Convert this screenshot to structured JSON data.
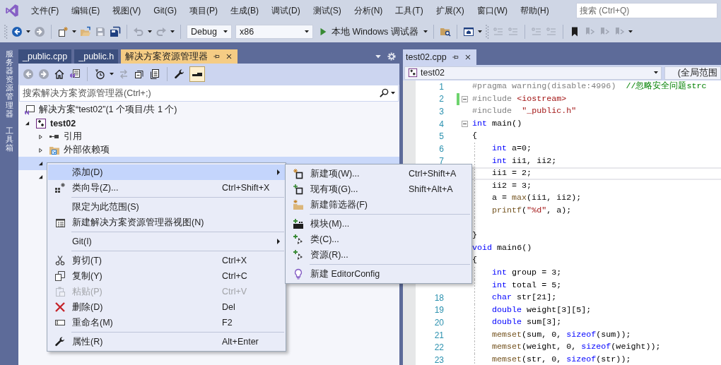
{
  "menu_bar": {
    "items": [
      "文件(F)",
      "编辑(E)",
      "视图(V)",
      "Git(G)",
      "项目(P)",
      "生成(B)",
      "调试(D)",
      "测试(S)",
      "分析(N)",
      "工具(T)",
      "扩展(X)",
      "窗口(W)",
      "帮助(H)"
    ],
    "search": {
      "placeholder": "搜索 (Ctrl+Q)"
    }
  },
  "toolbar": {
    "configuration": "Debug",
    "platform": "x86",
    "run_target": "本地 Windows 调试器"
  },
  "side_tabs": [
    "服务器资源管理器",
    "工具箱"
  ],
  "solution_explorer": {
    "tabs": [
      {
        "label": "_public.cpp",
        "selected": false
      },
      {
        "label": "_public.h",
        "selected": false
      },
      {
        "label": "解决方案资源管理器",
        "selected": true
      }
    ],
    "preview_toggle": {
      "on": true
    },
    "search": {
      "placeholder": "搜索解决方案资源管理器(Ctrl+;)"
    },
    "tree": [
      {
        "label": "解决方案“test02”(1 个项目/共 1 个)",
        "children": [
          {
            "label": "test02",
            "expanded": true,
            "selected": false,
            "children": [
              {
                "label": "引用",
                "expanded": false,
                "selected": false
              },
              {
                "label": "外部依赖项",
                "expanded": false,
                "selected": false
              },
              {
                "expanded": true,
                "selected": true
              },
              {
                "expanded": true,
                "selected": false
              }
            ]
          }
        ]
      }
    ]
  },
  "context_menu": {
    "items": [
      {
        "kind": "item",
        "label": "添加(D)",
        "submenu": true,
        "selected": true,
        "disabled": false
      },
      {
        "kind": "item",
        "label": "类向导(Z)...",
        "shortcut": "Ctrl+Shift+X",
        "submenu": false,
        "selected": false,
        "disabled": false
      },
      {
        "kind": "separator"
      },
      {
        "kind": "item",
        "label": "限定为此范围(S)",
        "submenu": false,
        "selected": false,
        "disabled": false
      },
      {
        "kind": "item",
        "label": "新建解决方案资源管理器视图(N)",
        "submenu": false,
        "selected": false,
        "disabled": false
      },
      {
        "kind": "separator"
      },
      {
        "kind": "item",
        "label": "Git(I)",
        "submenu": true,
        "selected": false,
        "disabled": false
      },
      {
        "kind": "separator"
      },
      {
        "kind": "item",
        "label": "剪切(T)",
        "shortcut": "Ctrl+X",
        "submenu": false,
        "selected": false,
        "disabled": false
      },
      {
        "kind": "item",
        "label": "复制(Y)",
        "shortcut": "Ctrl+C",
        "submenu": false,
        "selected": false,
        "disabled": false
      },
      {
        "kind": "item",
        "label": "粘贴(P)",
        "shortcut": "Ctrl+V",
        "submenu": false,
        "selected": false,
        "disabled": true
      },
      {
        "kind": "item",
        "label": "删除(D)",
        "shortcut": "Del",
        "submenu": false,
        "selected": false,
        "disabled": false
      },
      {
        "kind": "item",
        "label": "重命名(M)",
        "shortcut": "F2",
        "submenu": false,
        "selected": false,
        "disabled": false
      },
      {
        "kind": "separator"
      },
      {
        "kind": "item",
        "label": "属性(R)",
        "shortcut": "Alt+Enter",
        "submenu": false,
        "selected": false,
        "disabled": false
      }
    ]
  },
  "submenu": {
    "items": [
      {
        "kind": "item",
        "label": "新建项(W)...",
        "shortcut": "Ctrl+Shift+A",
        "selected": false,
        "disabled": false
      },
      {
        "kind": "item",
        "label": "现有项(G)...",
        "shortcut": "Shift+Alt+A",
        "selected": false,
        "disabled": false
      },
      {
        "kind": "item",
        "label": "新建筛选器(F)",
        "selected": false,
        "disabled": false
      },
      {
        "kind": "separator"
      },
      {
        "kind": "item",
        "label": "模块(M)...",
        "selected": false,
        "disabled": false
      },
      {
        "kind": "item",
        "label": "类(C)...",
        "selected": false,
        "disabled": false
      },
      {
        "kind": "item",
        "label": "资源(R)...",
        "selected": false,
        "disabled": false
      },
      {
        "kind": "separator"
      },
      {
        "kind": "item",
        "label": "新建 EditorConfig",
        "selected": false,
        "disabled": false
      }
    ]
  },
  "editor": {
    "tabs": [
      {
        "label": "test02.cpp",
        "selected": true
      }
    ],
    "scope": "test02",
    "scope_2": "(全局范围",
    "lines": [
      {
        "number": "1",
        "tokens": [
          {
            "kind": "preprocessor",
            "text": "#pragma warning(disable:4996)"
          },
          {
            "kind": "comment",
            "text": "  //忽略安全问题strc"
          }
        ],
        "indented": false,
        "fold": false,
        "modified": false,
        "current": false
      },
      {
        "number": "2",
        "tokens": [
          {
            "kind": "preprocessor",
            "text": "#include "
          },
          {
            "kind": "string",
            "text": "<iostream>"
          }
        ],
        "indented": false,
        "fold": true,
        "modified": true,
        "current": false
      },
      {
        "number": "3",
        "tokens": [
          {
            "kind": "preprocessor",
            "text": "#include  "
          },
          {
            "kind": "string",
            "text": "\"_public.h\""
          }
        ],
        "indented": false,
        "fold": false,
        "modified": false,
        "current": false
      },
      {
        "number": "4",
        "tokens": [
          {
            "kind": "keyword",
            "text": "int"
          },
          {
            "kind": "plain",
            "text": " main()"
          }
        ],
        "indented": false,
        "fold": true,
        "modified": false,
        "current": false
      },
      {
        "number": "5",
        "tokens": [
          {
            "kind": "plain",
            "text": "{"
          }
        ],
        "indented": false,
        "fold": false,
        "modified": false,
        "current": false
      },
      {
        "number": "6",
        "tokens": [
          {
            "kind": "keyword",
            "text": "int"
          },
          {
            "kind": "plain",
            "text": " a=0;"
          }
        ],
        "indented": true,
        "fold": false,
        "modified": false,
        "current": false
      },
      {
        "number": "7",
        "tokens": [
          {
            "kind": "keyword",
            "text": "int"
          },
          {
            "kind": "plain",
            "text": " ii1, ii2;"
          }
        ],
        "indented": true,
        "fold": false,
        "modified": false,
        "current": false
      },
      {
        "tokens": [
          {
            "kind": "plain",
            "text": "ii1 = 2;"
          }
        ],
        "indented": true,
        "fold": false,
        "modified": false,
        "current": true
      },
      {
        "tokens": [
          {
            "kind": "plain",
            "text": "ii2 = 3;"
          }
        ],
        "indented": true,
        "fold": false,
        "modified": false,
        "current": false
      },
      {
        "tokens": [
          {
            "kind": "plain",
            "text": "a = "
          },
          {
            "kind": "function",
            "text": "max"
          },
          {
            "kind": "plain",
            "text": "(ii1, ii2);"
          }
        ],
        "indented": true,
        "fold": false,
        "modified": false,
        "current": false
      },
      {
        "tokens": [
          {
            "kind": "function",
            "text": "printf"
          },
          {
            "kind": "plain",
            "text": "("
          },
          {
            "kind": "string",
            "text": "\"%d\""
          },
          {
            "kind": "plain",
            "text": ", a);"
          }
        ],
        "indented": true,
        "fold": false,
        "modified": false,
        "current": false
      },
      {
        "kind": "blank"
      },
      {
        "tokens": [
          {
            "kind": "plain",
            "text": "}"
          }
        ],
        "indented": false,
        "fold": false,
        "modified": false,
        "current": false
      },
      {
        "tokens": [
          {
            "kind": "keyword",
            "text": "void"
          },
          {
            "kind": "plain",
            "text": " main6()"
          }
        ],
        "indented": false,
        "fold": false,
        "modified": false,
        "current": false
      },
      {
        "tokens": [
          {
            "kind": "plain",
            "text": "{"
          }
        ],
        "indented": false,
        "fold": false,
        "modified": false,
        "current": false
      },
      {
        "tokens": [
          {
            "kind": "keyword",
            "text": "int"
          },
          {
            "kind": "plain",
            "text": " group = 3;"
          }
        ],
        "indented": true,
        "fold": false,
        "modified": false,
        "current": false
      },
      {
        "tokens": [
          {
            "kind": "keyword",
            "text": "int"
          },
          {
            "kind": "plain",
            "text": " total = 5;"
          }
        ],
        "indented": true,
        "fold": false,
        "modified": false,
        "current": false
      },
      {
        "number": "18",
        "tokens": [
          {
            "kind": "keyword",
            "text": "char"
          },
          {
            "kind": "plain",
            "text": " str[21];"
          }
        ],
        "indented": true,
        "fold": false,
        "modified": false,
        "current": false
      },
      {
        "number": "19",
        "tokens": [
          {
            "kind": "keyword",
            "text": "double"
          },
          {
            "kind": "plain",
            "text": " weight[3][5];"
          }
        ],
        "indented": true,
        "fold": false,
        "modified": false,
        "current": false
      },
      {
        "number": "20",
        "tokens": [
          {
            "kind": "keyword",
            "text": "double"
          },
          {
            "kind": "plain",
            "text": " sum[3];"
          }
        ],
        "indented": true,
        "fold": false,
        "modified": false,
        "current": false
      },
      {
        "number": "21",
        "tokens": [
          {
            "kind": "function",
            "text": "memset"
          },
          {
            "kind": "plain",
            "text": "(sum, 0, "
          },
          {
            "kind": "keyword",
            "text": "sizeof"
          },
          {
            "kind": "plain",
            "text": "(sum));"
          }
        ],
        "indented": true,
        "fold": false,
        "modified": false,
        "current": false
      },
      {
        "number": "22",
        "tokens": [
          {
            "kind": "function",
            "text": "memset"
          },
          {
            "kind": "plain",
            "text": "(weight, 0, "
          },
          {
            "kind": "keyword",
            "text": "sizeof"
          },
          {
            "kind": "plain",
            "text": "(weight));"
          }
        ],
        "indented": true,
        "fold": false,
        "modified": false,
        "current": false
      },
      {
        "number": "23",
        "tokens": [
          {
            "kind": "function",
            "text": "memset"
          },
          {
            "kind": "plain",
            "text": "(str, 0, "
          },
          {
            "kind": "keyword",
            "text": "sizeof"
          },
          {
            "kind": "plain",
            "text": "(str));"
          }
        ],
        "indented": true,
        "fold": false,
        "modified": false,
        "current": false
      }
    ]
  }
}
